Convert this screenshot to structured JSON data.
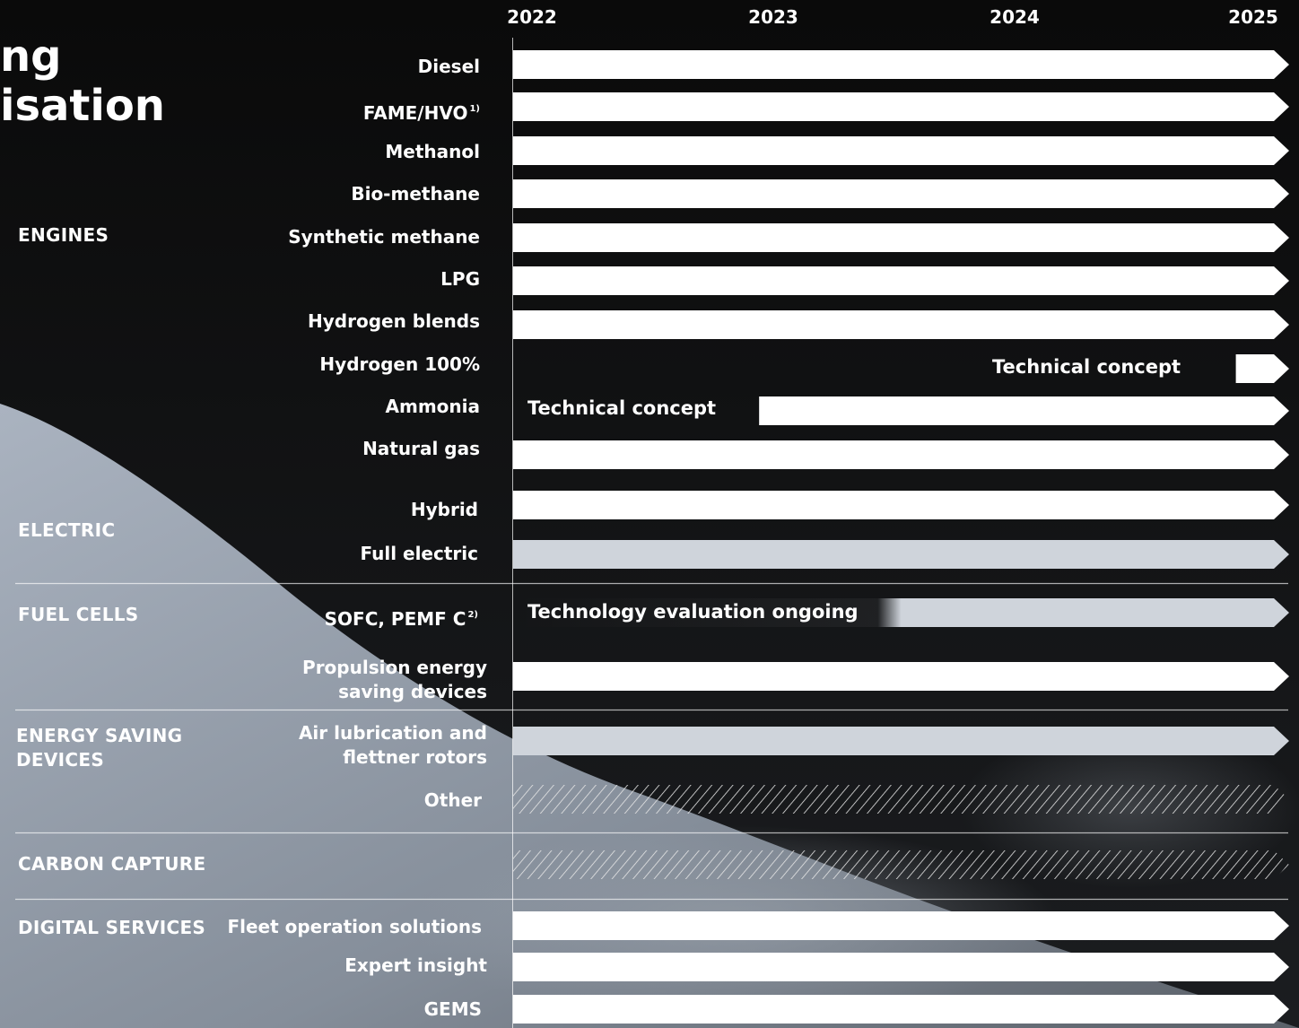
{
  "page": {
    "title_line1": "ng",
    "title_line2": "isation"
  },
  "colors": {
    "bar_available": "#ffffff",
    "bar_other": "#cfd4db",
    "hatch": "#e6e6e6",
    "text": "#ffffff",
    "background": "#0c0c0c"
  },
  "chart_data": {
    "type": "bar",
    "orientation": "horizontal",
    "x_ticks": [
      "2022",
      "2023",
      "2024",
      "2025"
    ],
    "xlim": [
      2022,
      2025
    ],
    "groups": [
      {
        "name": "ENGINES",
        "items": [
          "Diesel",
          "FAME/HVO",
          "Methanol",
          "Bio-methane",
          "Synthetic methane",
          "LPG",
          "Hydrogen blends",
          "Hydrogen 100%",
          "Ammonia",
          "Natural gas"
        ]
      },
      {
        "name": "ELECTRIC",
        "items": [
          "Hybrid",
          "Full electric"
        ]
      },
      {
        "name": "FUEL CELLS",
        "items": [
          "SOFC, PEMF C"
        ]
      },
      {
        "name": "ENERGY SAVING DEVICES",
        "items": [
          "Propulsion energy saving devices",
          "Air lubrication and flettner rotors",
          "Other"
        ]
      },
      {
        "name": "CARBON CAPTURE",
        "items": [
          ""
        ]
      },
      {
        "name": "DIGITAL SERVICES",
        "items": [
          "Fleet operation solutions",
          "Expert insight",
          "GEMS"
        ]
      }
    ],
    "rows": [
      {
        "label": "Diesel",
        "start": 2022,
        "end": 2025,
        "style": "white"
      },
      {
        "label": "FAME/HVO",
        "sup": "1)",
        "start": 2022,
        "end": 2025,
        "style": "white"
      },
      {
        "label": "Methanol",
        "start": 2022,
        "end": 2025,
        "style": "white"
      },
      {
        "label": "Bio-methane",
        "start": 2022,
        "end": 2025,
        "style": "white"
      },
      {
        "label": "Synthetic methane",
        "start": 2022,
        "end": 2025,
        "style": "white"
      },
      {
        "label": "LPG",
        "start": 2022,
        "end": 2025,
        "style": "white"
      },
      {
        "label": "Hydrogen blends",
        "start": 2022,
        "end": 2025,
        "style": "white"
      },
      {
        "label": "Hydrogen 100%",
        "start": 2024.85,
        "end": 2025,
        "style": "white",
        "annotation": "Technical concept"
      },
      {
        "label": "Ammonia",
        "start": 2022.97,
        "end": 2025,
        "style": "white",
        "annotation": "Technical concept"
      },
      {
        "label": "Natural gas",
        "start": 2022,
        "end": 2025,
        "style": "white"
      },
      {
        "label": "Hybrid",
        "start": 2022,
        "end": 2025,
        "style": "white"
      },
      {
        "label": "Full electric",
        "start": 2022,
        "end": 2025,
        "style": "grey"
      },
      {
        "label": "SOFC, PEMF C",
        "sup": "2)",
        "start": 2022,
        "end": 2025,
        "style": "grey",
        "annotation": "Technology evaluation ongoing"
      },
      {
        "label_lines": [
          "Propulsion energy",
          "saving devices"
        ],
        "start": 2022,
        "end": 2025,
        "style": "white"
      },
      {
        "label_lines": [
          "Air lubrication and",
          "flettner rotors"
        ],
        "start": 2022,
        "end": 2025,
        "style": "grey"
      },
      {
        "label": "Other",
        "start": 2022,
        "end": 2025,
        "style": "hatched"
      },
      {
        "label": "",
        "start": 2022,
        "end": 2025,
        "style": "hatched"
      },
      {
        "label": "Fleet operation solutions",
        "start": 2022,
        "end": 2025,
        "style": "white"
      },
      {
        "label": "Expert insight",
        "start": 2022,
        "end": 2025,
        "style": "white"
      },
      {
        "label": "GEMS",
        "start": 2022,
        "end": 2025,
        "style": "white"
      }
    ]
  }
}
